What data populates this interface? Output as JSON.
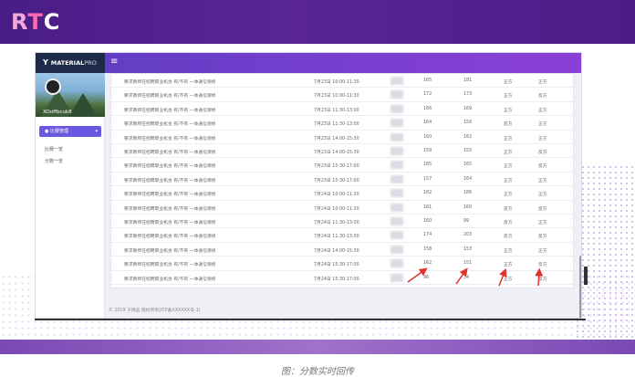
{
  "banner": {
    "logo": {
      "r": "R",
      "t": "T",
      "c": "C"
    }
  },
  "app": {
    "brand": "MATERIAL",
    "brand_suffix": "PRO",
    "menu_icon": "hamburger-menu-icon",
    "username": "XOoffbcuk8",
    "menu_active": "比赛管理",
    "submenu": [
      "比赛一览",
      "分数一览"
    ],
    "footer": "© 2019 子佛品 版权所有(ICP备XXXXXX号-1)"
  },
  "rows": [
    {
      "title": "要求教师在招聘职业机会 有/不有 一体通信保修",
      "time": "7月23日 10:00-11:30",
      "s1": "165",
      "s2": "181",
      "p1": "正方",
      "p2": "正方"
    },
    {
      "title": "要求教师在招聘职业机会 有/不有 一体通信保修",
      "time": "7月23日 10:00-11:30",
      "s1": "172",
      "s2": "173",
      "p1": "正方",
      "p2": "反方"
    },
    {
      "title": "要求教师在招聘职业机会 有/不有 一体通信保修",
      "time": "7月23日 11:30-13:00",
      "s1": "166",
      "s2": "169",
      "p1": "正方",
      "p2": "正方"
    },
    {
      "title": "要求教师在招聘职业机会 有/不有 一体通信保修",
      "time": "7月23日 11:30-13:00",
      "s1": "164",
      "s2": "156",
      "p1": "反方",
      "p2": "正方"
    },
    {
      "title": "要求教师在招聘职业机会 有/不有 一体通信保修",
      "time": "7月23日 14:00-15:30",
      "s1": "160",
      "s2": "162",
      "p1": "正方",
      "p2": "正方"
    },
    {
      "title": "要求教师在招聘职业机会 有/不有 一体通信保修",
      "time": "7月23日 14:00-15:30",
      "s1": "159",
      "s2": "155",
      "p1": "正方",
      "p2": "反方"
    },
    {
      "title": "要求教师在招聘职业机会 有/不有 一体通信保修",
      "time": "7月23日 15:30-17:00",
      "s1": "165",
      "s2": "165",
      "p1": "正方",
      "p2": "反方"
    },
    {
      "title": "要求教师在招聘职业机会 有/不有 一体通信保修",
      "time": "7月23日 15:30-17:00",
      "s1": "157",
      "s2": "164",
      "p1": "正方",
      "p2": "正方"
    },
    {
      "title": "要求教师在招聘职业机会 有/不有 一体通信保修",
      "time": "7月24日 10:00-11:30",
      "s1": "182",
      "s2": "186",
      "p1": "正方",
      "p2": "正方"
    },
    {
      "title": "要求教师在招聘职业机会 有/不有 一体通信保修",
      "time": "7月24日 10:00-11:30",
      "s1": "161",
      "s2": "160",
      "p1": "反方",
      "p2": "反方"
    },
    {
      "title": "要求教师在招聘职业机会 有/不有 一体通信保修",
      "time": "7月24日 11:30-13:00",
      "s1": "160",
      "s2": "99",
      "p1": "反方",
      "p2": "正方"
    },
    {
      "title": "要求教师在招聘职业机会 有/不有 一体通信保修",
      "time": "7月24日 11:30-13:00",
      "s1": "174",
      "s2": "203",
      "p1": "反方",
      "p2": "反方"
    },
    {
      "title": "要求教师在招聘职业机会 有/不有 一体通信保修",
      "time": "7月24日 14:00-15:30",
      "s1": "158",
      "s2": "153",
      "p1": "正方",
      "p2": "正方"
    },
    {
      "title": "要求教师在招聘职业机会 有/不有 一体通信保修",
      "time": "7月24日 15:30-17:00",
      "s1": "162",
      "s2": "151",
      "p1": "正方",
      "p2": "反方"
    },
    {
      "title": "要求教师在招聘职业机会 有/不有 一体通信保修",
      "time": "7月24日 15:30-17:00",
      "s1": "96",
      "s2": "34",
      "p1": "正方",
      "p2": "反方"
    }
  ],
  "caption": "图：分数实时回传",
  "colors": {
    "banner": "#4a1d86",
    "topbar": "#6a3fcc",
    "menu_active": "#6a58e0",
    "arrow": "#e0312a"
  }
}
